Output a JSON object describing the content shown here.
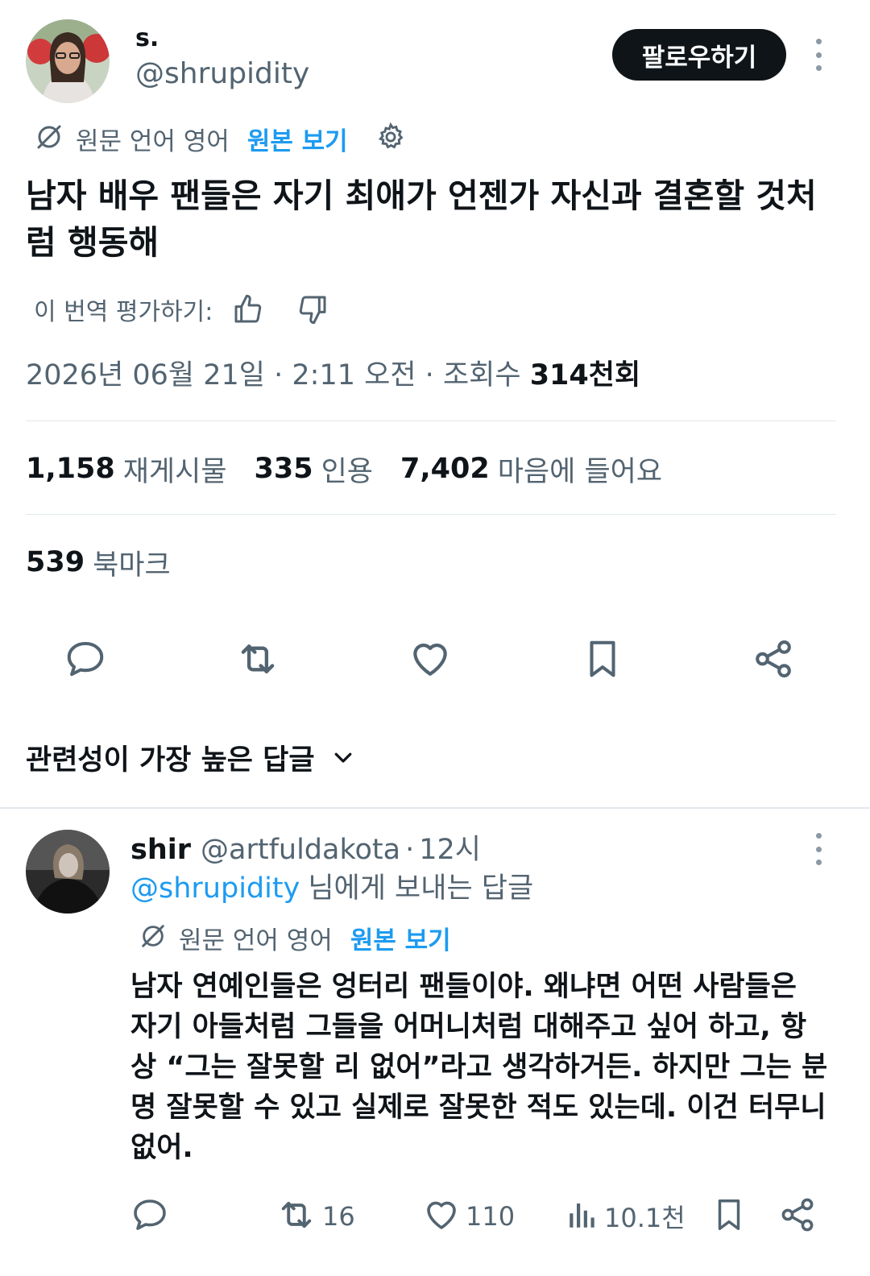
{
  "tweet": {
    "author": {
      "display_name": "s.",
      "handle": "@shrupidity"
    },
    "follow_label": "팔로우하기",
    "translation": {
      "original_language": "원문 언어 영어",
      "view_original": "원본 보기"
    },
    "text": "남자 배우 팬들은 자기 최애가 언젠가 자신과 결혼할 것처럼 행동해",
    "rate_label": "이 번역 평가하기:",
    "meta": {
      "date": "2026년 06월 21일",
      "time": "2:11 오전",
      "views_label": "조회수",
      "views_value": "314천회"
    },
    "stats": {
      "reposts": {
        "value": "1,158",
        "label": "재게시물"
      },
      "quotes": {
        "value": "335",
        "label": "인용"
      },
      "likes": {
        "value": "7,402",
        "label": "마음에 들어요"
      },
      "bookmarks": {
        "value": "539",
        "label": "북마크"
      }
    },
    "actions": [
      "reply-icon",
      "repost-icon",
      "like-icon",
      "bookmark-icon",
      "share-icon"
    ]
  },
  "sort": {
    "label": "관련성이 가장 높은 답글"
  },
  "reply": {
    "author": {
      "display_name": "shir",
      "handle": "@artfuldakota",
      "time": "12시"
    },
    "separator": "·",
    "reply_to": {
      "mention": "@shrupidity",
      "rest": "님에게 보내는 답글"
    },
    "translation": {
      "original_language": "원문 언어 영어",
      "view_original": "원본 보기"
    },
    "text": "남자 연예인들은 엉터리 팬들이야. 왜냐면 어떤 사람들은 자기 아들처럼 그들을 어머니처럼 대해주고 싶어 하고, 항상 “그는 잘못할 리 없어”라고 생각하거든. 하지만 그는 분명 잘못할 수 있고 실제로 잘못한 적도 있는데. 이건 터무니없어.",
    "counts": {
      "reposts": "16",
      "likes": "110",
      "views": "10.1천"
    }
  },
  "colors": {
    "text_primary": "#0f1419",
    "text_secondary": "#536471",
    "accent": "#1d9bf0",
    "divider": "#e1e8ed"
  }
}
